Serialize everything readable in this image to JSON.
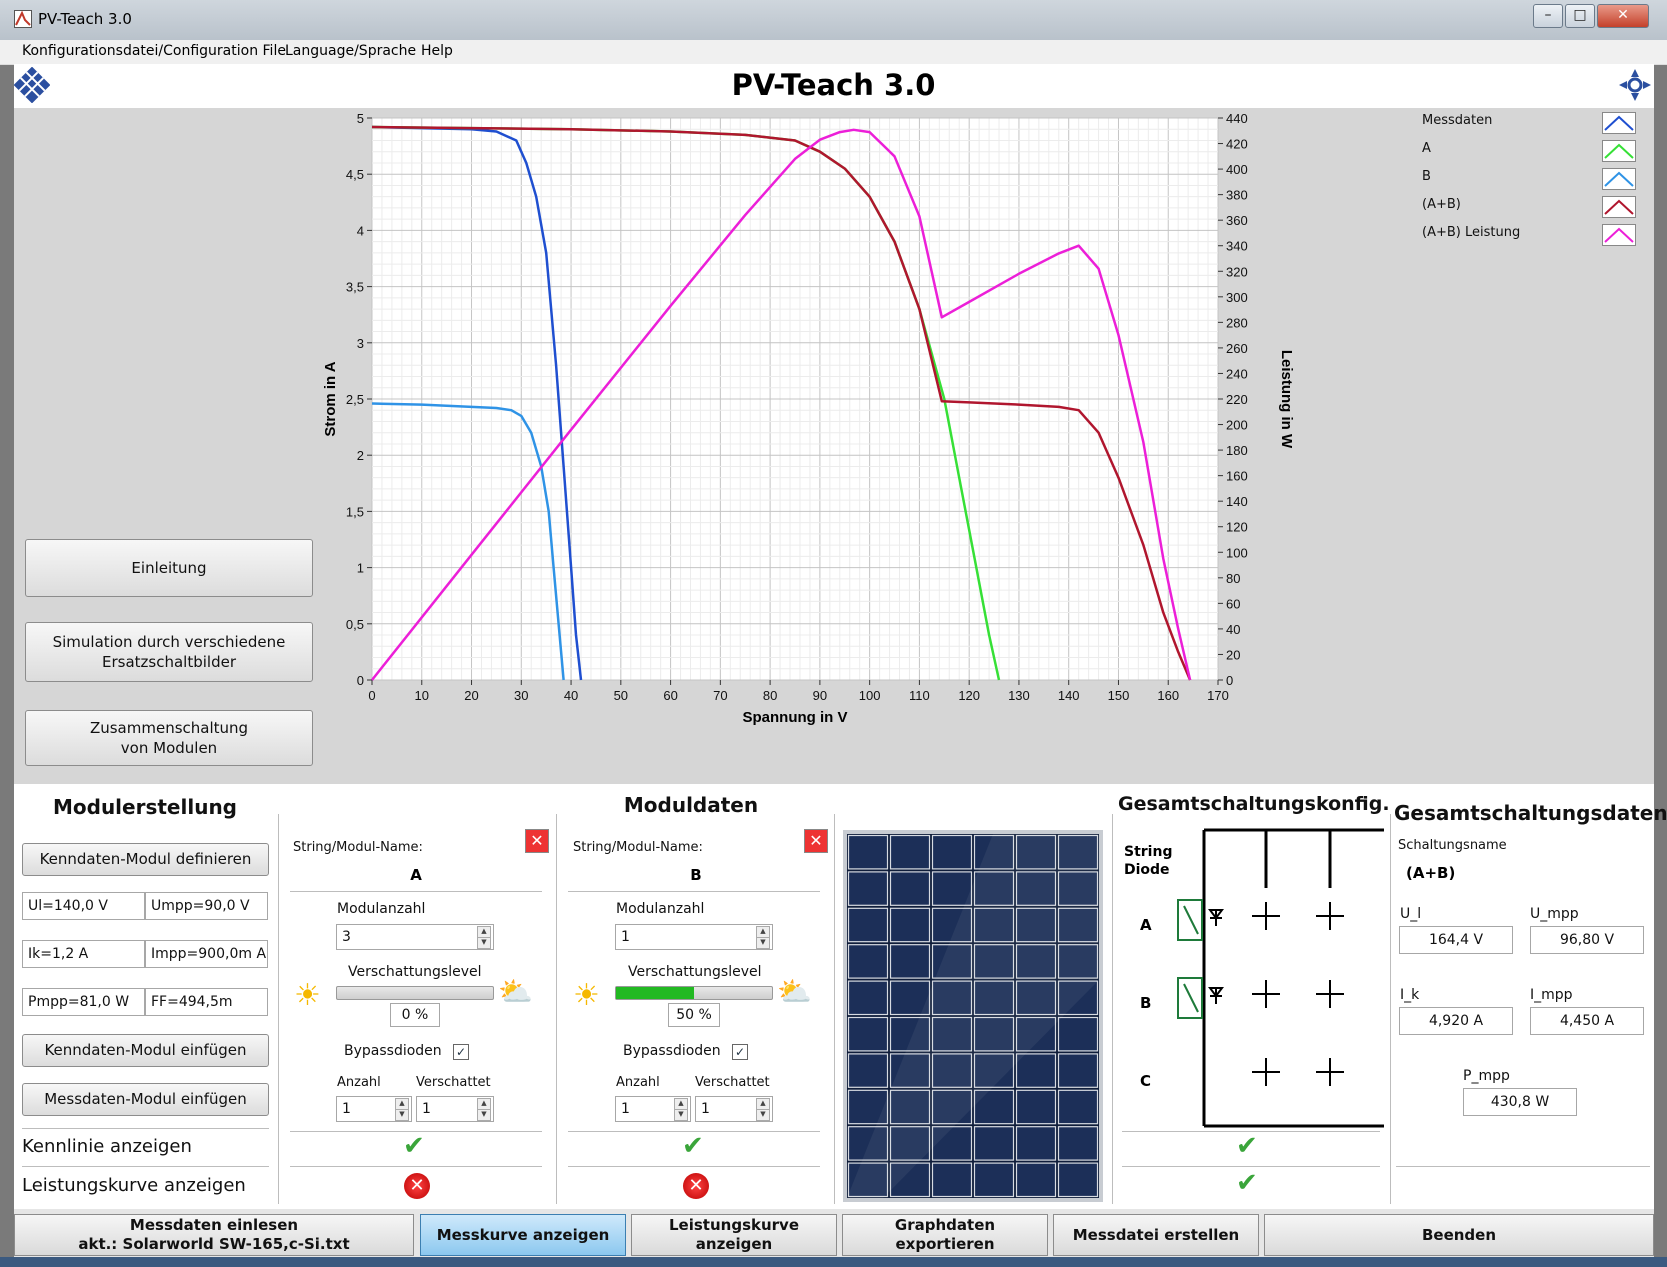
{
  "window": {
    "title": "PV-Teach 3.0",
    "minimize": "–",
    "maximize": "□",
    "close": "✕"
  },
  "menu": [
    "Konfigurationsdatei/Configuration File",
    "Language/Sprache",
    "Help"
  ],
  "header": {
    "title": "PV-Teach 3.0",
    "logo_left_icon": "solar-cell-logo-icon",
    "logo_right_icon": "satellite-logo-icon"
  },
  "nav": {
    "intro": "Einleitung",
    "simulation": [
      "Simulation durch verschiedene",
      "Ersatzschaltbilder"
    ],
    "combine": [
      "Zusammenschaltung",
      "von Modulen"
    ]
  },
  "chart_data": {
    "type": "line",
    "xlabel": "Spannung in V",
    "ylabel": "Strom in A",
    "y2label": "Leistung in W",
    "xlim": [
      0,
      170
    ],
    "ylim": [
      0,
      5
    ],
    "y2lim": [
      0,
      440
    ],
    "xticks": [
      "0",
      "10",
      "20",
      "30",
      "40",
      "50",
      "60",
      "70",
      "80",
      "90",
      "100",
      "110",
      "120",
      "130",
      "140",
      "150",
      "160",
      "170"
    ],
    "yticks": [
      "0",
      "0,5",
      "1",
      "1,5",
      "2",
      "2,5",
      "3",
      "3,5",
      "4",
      "4,5",
      "5"
    ],
    "y2ticks": [
      "0",
      "20",
      "40",
      "60",
      "80",
      "100",
      "120",
      "140",
      "160",
      "180",
      "200",
      "220",
      "240",
      "260",
      "280",
      "300",
      "320",
      "340",
      "360",
      "380",
      "400",
      "420",
      "440"
    ],
    "grid": true,
    "series": [
      {
        "name": "Messdaten",
        "color": "#1f4fd0",
        "axis": "left",
        "x": [
          0,
          10,
          20,
          25,
          29,
          31,
          33,
          35,
          37,
          38.5,
          40,
          41,
          42
        ],
        "y": [
          4.92,
          4.91,
          4.9,
          4.88,
          4.8,
          4.6,
          4.3,
          3.8,
          2.8,
          1.9,
          1.0,
          0.4,
          0
        ]
      },
      {
        "name": "A",
        "color": "#36e036",
        "axis": "left",
        "x": [
          0,
          20,
          40,
          60,
          75,
          85,
          90,
          95,
          100,
          105,
          110,
          115,
          118,
          121,
          124,
          126
        ],
        "y": [
          4.92,
          4.91,
          4.9,
          4.88,
          4.85,
          4.8,
          4.7,
          4.55,
          4.3,
          3.9,
          3.3,
          2.5,
          1.8,
          1.1,
          0.4,
          0
        ]
      },
      {
        "name": "B",
        "color": "#2f93e6",
        "axis": "left",
        "x": [
          0,
          10,
          20,
          25,
          28,
          30,
          32,
          34,
          35.5,
          36.5,
          37.5,
          38.5
        ],
        "y": [
          2.46,
          2.45,
          2.43,
          2.42,
          2.4,
          2.35,
          2.2,
          1.9,
          1.5,
          1.0,
          0.5,
          0
        ]
      },
      {
        "name": "(A+B)",
        "color": "#b0162e",
        "axis": "left",
        "x": [
          0,
          20,
          40,
          60,
          75,
          85,
          90,
          95,
          100,
          105,
          110,
          114.5,
          120,
          130,
          138,
          142,
          146,
          150,
          155,
          159,
          162,
          164.4
        ],
        "y": [
          4.92,
          4.91,
          4.9,
          4.88,
          4.85,
          4.8,
          4.7,
          4.55,
          4.3,
          3.9,
          3.3,
          2.48,
          2.47,
          2.45,
          2.43,
          2.4,
          2.2,
          1.8,
          1.2,
          0.6,
          0.25,
          0
        ]
      },
      {
        "name": "(A+B)  Leistung",
        "color": "#ec1fd8",
        "axis": "right",
        "x": [
          0,
          20,
          40,
          60,
          75,
          85,
          90,
          94,
          96.8,
          100,
          105,
          110,
          114.5,
          120,
          130,
          138,
          142,
          146,
          150,
          155,
          159,
          162,
          164.4
        ],
        "y": [
          0,
          98,
          196,
          293,
          364,
          408,
          423,
          429,
          430.8,
          429,
          410,
          363,
          284,
          296,
          318,
          334,
          340,
          322,
          270,
          186,
          95,
          40,
          0
        ]
      }
    ]
  },
  "legend": [
    {
      "label": "Messdaten",
      "color": "#1f4fd0"
    },
    {
      "label": "A",
      "color": "#36e036"
    },
    {
      "label": "B",
      "color": "#2f93e6"
    },
    {
      "label": "(A+B)",
      "color": "#b0162e"
    },
    {
      "label": "(A+B)  Leistung",
      "color": "#ec1fd8"
    }
  ],
  "modulerstellung": {
    "title": "Modulerstellung",
    "define_btn": "Kenndaten-Modul definieren",
    "ul": "Ul=140,0 V",
    "umpp": "Umpp=90,0 V",
    "ik": "Ik=1,2 A",
    "impp": "Impp=900,0m A",
    "pmpp": "Pmpp=81,0 W",
    "ff": "FF=494,5m",
    "insert_btn": "Kenndaten-Modul einfügen",
    "measure_btn": "Messdaten-Modul einfügen",
    "show_curve": "Kennlinie anzeigen",
    "show_power": "Leistungskurve anzeigen"
  },
  "string_a": {
    "name_label": "String/Modul-Name:",
    "name": "A",
    "count_label": "Modulanzahl",
    "count": "3",
    "shade_label": "Verschattungslevel",
    "shade_value": "0 %",
    "shade_fraction": 0,
    "bypass_label": "Bypassdioden",
    "anzahl_label": "Anzahl",
    "verschattet_label": "Verschattet",
    "anzahl": "1",
    "verschattet": "1"
  },
  "moduldaten": {
    "title": "Moduldaten"
  },
  "string_b": {
    "name_label": "String/Modul-Name:",
    "name": "B",
    "count_label": "Modulanzahl",
    "count": "1",
    "shade_label": "Verschattungslevel",
    "shade_value": "50 %",
    "shade_fraction": 0.5,
    "bypass_label": "Bypassdioden",
    "anzahl_label": "Anzahl",
    "verschattet_label": "Verschattet",
    "anzahl": "1",
    "verschattet": "1"
  },
  "config": {
    "title": "Gesamtschaltungskonfig.",
    "col_header": [
      "String",
      "Diode"
    ],
    "rows": [
      "A",
      "B",
      "C"
    ]
  },
  "totals": {
    "title": "Gesamtschaltungsdaten",
    "name_label": "Schaltungsname",
    "name": "(A+B)",
    "ul_label": "U_l",
    "ul": "164,4 V",
    "umpp_label": "U_mpp",
    "umpp": "96,80 V",
    "ik_label": "I_k",
    "ik": "4,920 A",
    "impp_label": "I_mpp",
    "impp": "4,450 A",
    "pmpp_label": "P_mpp",
    "pmpp": "430,8 W"
  },
  "tabs": {
    "read": [
      "Messdaten einlesen",
      "akt.: Solarworld SW-165,c-Si.txt"
    ],
    "show_measure": "Messkurve anzeigen",
    "show_power": "Leistungskurve anzeigen",
    "export": "Graphdaten exportieren",
    "create": "Messdatei erstellen",
    "quit": "Beenden"
  }
}
